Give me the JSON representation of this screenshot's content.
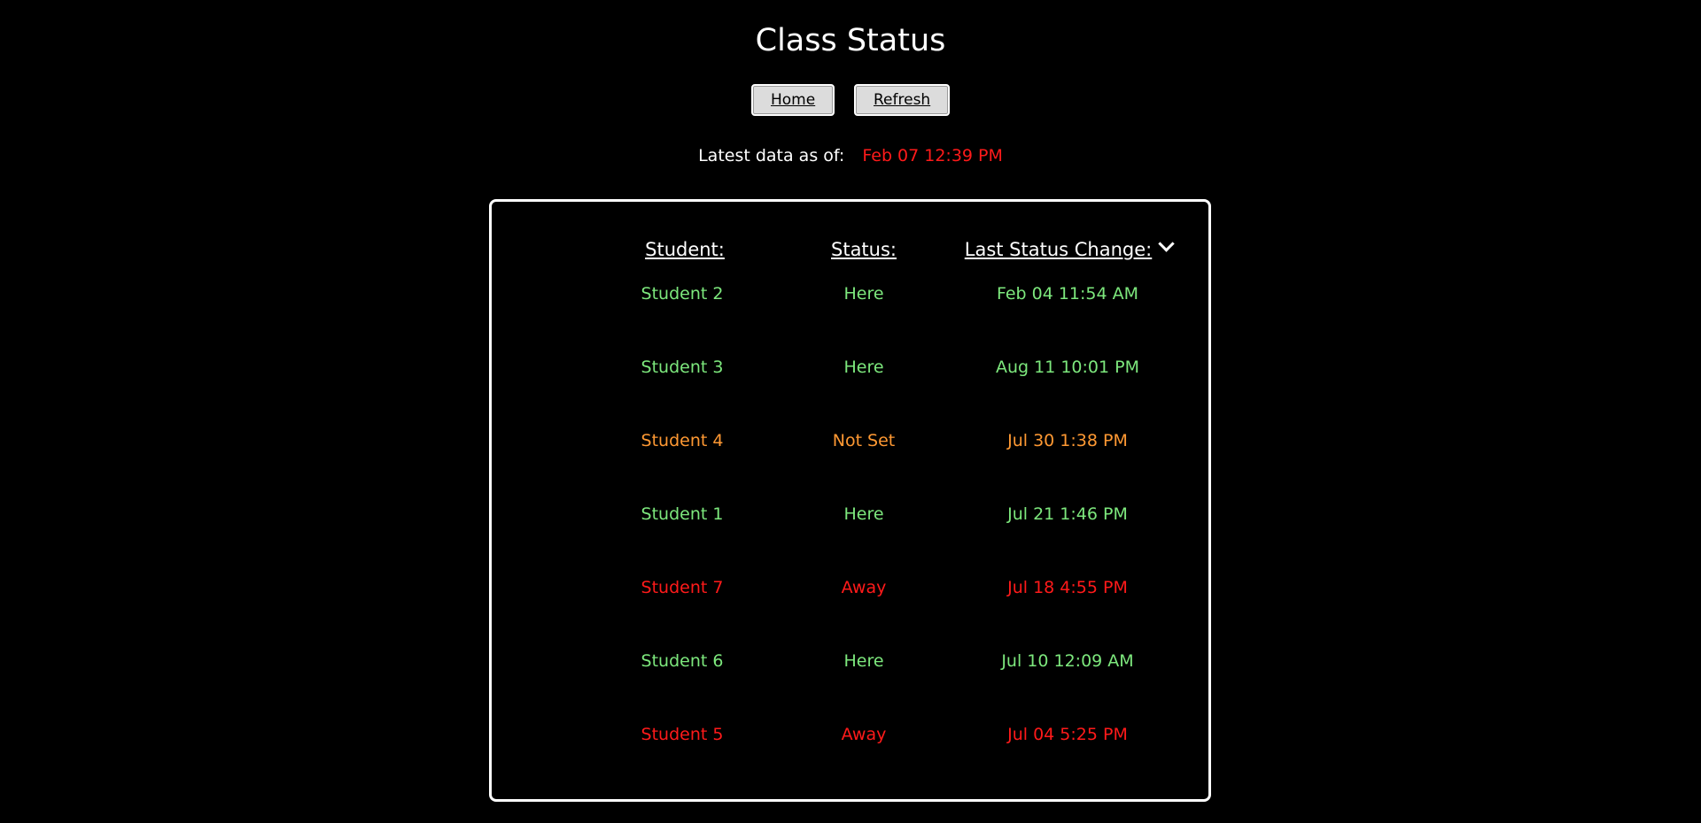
{
  "page": {
    "title": "Class Status"
  },
  "buttons": {
    "home_label": "Home",
    "refresh_label": "Refresh"
  },
  "latest": {
    "label": "Latest data as of:",
    "value": "Feb 07 12:39 PM",
    "value_color": "#ff1a1a"
  },
  "table": {
    "headers": {
      "student": "Student:",
      "status": "Status:",
      "last_change": "Last Status Change:",
      "sort_icon": "chevron-down-icon"
    },
    "colors": {
      "Here": "#7de87d",
      "Not Set": "#ff9933",
      "Away": "#ff1a1a"
    },
    "rows": [
      {
        "student": "Student 2",
        "status": "Here",
        "changed": "Feb 04 11:54 AM"
      },
      {
        "student": "Student 3",
        "status": "Here",
        "changed": "Aug 11 10:01 PM"
      },
      {
        "student": "Student 4",
        "status": "Not Set",
        "changed": "Jul 30 1:38 PM"
      },
      {
        "student": "Student 1",
        "status": "Here",
        "changed": "Jul 21 1:46 PM"
      },
      {
        "student": "Student 7",
        "status": "Away",
        "changed": "Jul 18 4:55 PM"
      },
      {
        "student": "Student 6",
        "status": "Here",
        "changed": "Jul 10 12:09 AM"
      },
      {
        "student": "Student 5",
        "status": "Away",
        "changed": "Jul 04 5:25 PM"
      }
    ]
  }
}
